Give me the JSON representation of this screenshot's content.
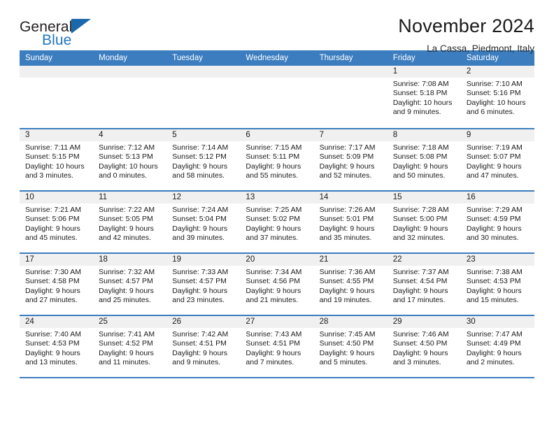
{
  "brand": {
    "name_part1": "General",
    "name_part2": "Blue",
    "triangle_color": "#1b69ad",
    "blue_text_color": "#2077c0"
  },
  "header": {
    "month_title": "November 2024",
    "location": "La Cassa, Piedmont, Italy"
  },
  "theme": {
    "header_blue": "#3b7dbf",
    "day_strip_gray": "#f0f0f0"
  },
  "weekdays": [
    "Sunday",
    "Monday",
    "Tuesday",
    "Wednesday",
    "Thursday",
    "Friday",
    "Saturday"
  ],
  "weeks": [
    {
      "days": [
        {
          "date": "",
          "empty": true,
          "sunrise": "",
          "sunset": "",
          "daylight_line1": "",
          "daylight_line2": ""
        },
        {
          "date": "",
          "empty": true,
          "sunrise": "",
          "sunset": "",
          "daylight_line1": "",
          "daylight_line2": ""
        },
        {
          "date": "",
          "empty": true,
          "sunrise": "",
          "sunset": "",
          "daylight_line1": "",
          "daylight_line2": ""
        },
        {
          "date": "",
          "empty": true,
          "sunrise": "",
          "sunset": "",
          "daylight_line1": "",
          "daylight_line2": ""
        },
        {
          "date": "",
          "empty": true,
          "sunrise": "",
          "sunset": "",
          "daylight_line1": "",
          "daylight_line2": ""
        },
        {
          "date": "1",
          "empty": false,
          "sunrise": "Sunrise: 7:08 AM",
          "sunset": "Sunset: 5:18 PM",
          "daylight_line1": "Daylight: 10 hours",
          "daylight_line2": "and 9 minutes."
        },
        {
          "date": "2",
          "empty": false,
          "sunrise": "Sunrise: 7:10 AM",
          "sunset": "Sunset: 5:16 PM",
          "daylight_line1": "Daylight: 10 hours",
          "daylight_line2": "and 6 minutes."
        }
      ]
    },
    {
      "days": [
        {
          "date": "3",
          "empty": false,
          "sunrise": "Sunrise: 7:11 AM",
          "sunset": "Sunset: 5:15 PM",
          "daylight_line1": "Daylight: 10 hours",
          "daylight_line2": "and 3 minutes."
        },
        {
          "date": "4",
          "empty": false,
          "sunrise": "Sunrise: 7:12 AM",
          "sunset": "Sunset: 5:13 PM",
          "daylight_line1": "Daylight: 10 hours",
          "daylight_line2": "and 0 minutes."
        },
        {
          "date": "5",
          "empty": false,
          "sunrise": "Sunrise: 7:14 AM",
          "sunset": "Sunset: 5:12 PM",
          "daylight_line1": "Daylight: 9 hours",
          "daylight_line2": "and 58 minutes."
        },
        {
          "date": "6",
          "empty": false,
          "sunrise": "Sunrise: 7:15 AM",
          "sunset": "Sunset: 5:11 PM",
          "daylight_line1": "Daylight: 9 hours",
          "daylight_line2": "and 55 minutes."
        },
        {
          "date": "7",
          "empty": false,
          "sunrise": "Sunrise: 7:17 AM",
          "sunset": "Sunset: 5:09 PM",
          "daylight_line1": "Daylight: 9 hours",
          "daylight_line2": "and 52 minutes."
        },
        {
          "date": "8",
          "empty": false,
          "sunrise": "Sunrise: 7:18 AM",
          "sunset": "Sunset: 5:08 PM",
          "daylight_line1": "Daylight: 9 hours",
          "daylight_line2": "and 50 minutes."
        },
        {
          "date": "9",
          "empty": false,
          "sunrise": "Sunrise: 7:19 AM",
          "sunset": "Sunset: 5:07 PM",
          "daylight_line1": "Daylight: 9 hours",
          "daylight_line2": "and 47 minutes."
        }
      ]
    },
    {
      "days": [
        {
          "date": "10",
          "empty": false,
          "sunrise": "Sunrise: 7:21 AM",
          "sunset": "Sunset: 5:06 PM",
          "daylight_line1": "Daylight: 9 hours",
          "daylight_line2": "and 45 minutes."
        },
        {
          "date": "11",
          "empty": false,
          "sunrise": "Sunrise: 7:22 AM",
          "sunset": "Sunset: 5:05 PM",
          "daylight_line1": "Daylight: 9 hours",
          "daylight_line2": "and 42 minutes."
        },
        {
          "date": "12",
          "empty": false,
          "sunrise": "Sunrise: 7:24 AM",
          "sunset": "Sunset: 5:04 PM",
          "daylight_line1": "Daylight: 9 hours",
          "daylight_line2": "and 39 minutes."
        },
        {
          "date": "13",
          "empty": false,
          "sunrise": "Sunrise: 7:25 AM",
          "sunset": "Sunset: 5:02 PM",
          "daylight_line1": "Daylight: 9 hours",
          "daylight_line2": "and 37 minutes."
        },
        {
          "date": "14",
          "empty": false,
          "sunrise": "Sunrise: 7:26 AM",
          "sunset": "Sunset: 5:01 PM",
          "daylight_line1": "Daylight: 9 hours",
          "daylight_line2": "and 35 minutes."
        },
        {
          "date": "15",
          "empty": false,
          "sunrise": "Sunrise: 7:28 AM",
          "sunset": "Sunset: 5:00 PM",
          "daylight_line1": "Daylight: 9 hours",
          "daylight_line2": "and 32 minutes."
        },
        {
          "date": "16",
          "empty": false,
          "sunrise": "Sunrise: 7:29 AM",
          "sunset": "Sunset: 4:59 PM",
          "daylight_line1": "Daylight: 9 hours",
          "daylight_line2": "and 30 minutes."
        }
      ]
    },
    {
      "days": [
        {
          "date": "17",
          "empty": false,
          "sunrise": "Sunrise: 7:30 AM",
          "sunset": "Sunset: 4:58 PM",
          "daylight_line1": "Daylight: 9 hours",
          "daylight_line2": "and 27 minutes."
        },
        {
          "date": "18",
          "empty": false,
          "sunrise": "Sunrise: 7:32 AM",
          "sunset": "Sunset: 4:57 PM",
          "daylight_line1": "Daylight: 9 hours",
          "daylight_line2": "and 25 minutes."
        },
        {
          "date": "19",
          "empty": false,
          "sunrise": "Sunrise: 7:33 AM",
          "sunset": "Sunset: 4:57 PM",
          "daylight_line1": "Daylight: 9 hours",
          "daylight_line2": "and 23 minutes."
        },
        {
          "date": "20",
          "empty": false,
          "sunrise": "Sunrise: 7:34 AM",
          "sunset": "Sunset: 4:56 PM",
          "daylight_line1": "Daylight: 9 hours",
          "daylight_line2": "and 21 minutes."
        },
        {
          "date": "21",
          "empty": false,
          "sunrise": "Sunrise: 7:36 AM",
          "sunset": "Sunset: 4:55 PM",
          "daylight_line1": "Daylight: 9 hours",
          "daylight_line2": "and 19 minutes."
        },
        {
          "date": "22",
          "empty": false,
          "sunrise": "Sunrise: 7:37 AM",
          "sunset": "Sunset: 4:54 PM",
          "daylight_line1": "Daylight: 9 hours",
          "daylight_line2": "and 17 minutes."
        },
        {
          "date": "23",
          "empty": false,
          "sunrise": "Sunrise: 7:38 AM",
          "sunset": "Sunset: 4:53 PM",
          "daylight_line1": "Daylight: 9 hours",
          "daylight_line2": "and 15 minutes."
        }
      ]
    },
    {
      "days": [
        {
          "date": "24",
          "empty": false,
          "sunrise": "Sunrise: 7:40 AM",
          "sunset": "Sunset: 4:53 PM",
          "daylight_line1": "Daylight: 9 hours",
          "daylight_line2": "and 13 minutes."
        },
        {
          "date": "25",
          "empty": false,
          "sunrise": "Sunrise: 7:41 AM",
          "sunset": "Sunset: 4:52 PM",
          "daylight_line1": "Daylight: 9 hours",
          "daylight_line2": "and 11 minutes."
        },
        {
          "date": "26",
          "empty": false,
          "sunrise": "Sunrise: 7:42 AM",
          "sunset": "Sunset: 4:51 PM",
          "daylight_line1": "Daylight: 9 hours",
          "daylight_line2": "and 9 minutes."
        },
        {
          "date": "27",
          "empty": false,
          "sunrise": "Sunrise: 7:43 AM",
          "sunset": "Sunset: 4:51 PM",
          "daylight_line1": "Daylight: 9 hours",
          "daylight_line2": "and 7 minutes."
        },
        {
          "date": "28",
          "empty": false,
          "sunrise": "Sunrise: 7:45 AM",
          "sunset": "Sunset: 4:50 PM",
          "daylight_line1": "Daylight: 9 hours",
          "daylight_line2": "and 5 minutes."
        },
        {
          "date": "29",
          "empty": false,
          "sunrise": "Sunrise: 7:46 AM",
          "sunset": "Sunset: 4:50 PM",
          "daylight_line1": "Daylight: 9 hours",
          "daylight_line2": "and 3 minutes."
        },
        {
          "date": "30",
          "empty": false,
          "sunrise": "Sunrise: 7:47 AM",
          "sunset": "Sunset: 4:49 PM",
          "daylight_line1": "Daylight: 9 hours",
          "daylight_line2": "and 2 minutes."
        }
      ]
    }
  ]
}
